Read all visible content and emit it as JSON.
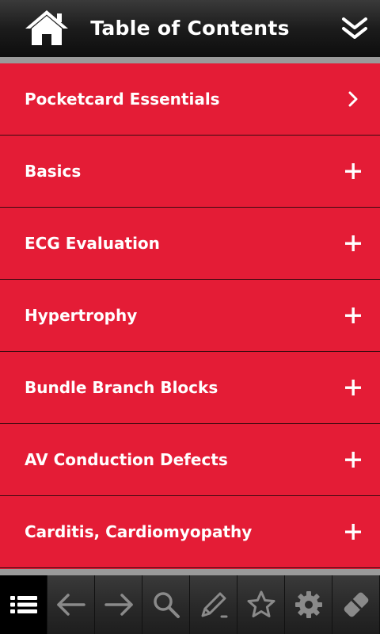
{
  "header": {
    "title": "Table of Contents",
    "home_icon": "home-icon",
    "collapse_icon": "double-chevron-down-icon"
  },
  "colors": {
    "accent": "#e41c36",
    "header_bg": "#1c1c1c",
    "separator": "#9a9a9a"
  },
  "toc": {
    "items": [
      {
        "label": "Pocketcard Essentials",
        "icon": "chevron-right-icon"
      },
      {
        "label": "Basics",
        "icon": "plus-icon"
      },
      {
        "label": "ECG Evaluation",
        "icon": "plus-icon"
      },
      {
        "label": "Hypertrophy",
        "icon": "plus-icon"
      },
      {
        "label": "Bundle Branch Blocks",
        "icon": "plus-icon"
      },
      {
        "label": "AV Conduction Defects",
        "icon": "plus-icon"
      },
      {
        "label": "Carditis, Cardiomyopathy",
        "icon": "plus-icon"
      }
    ]
  },
  "toolbar": {
    "buttons": [
      {
        "icon": "list-icon",
        "active": true
      },
      {
        "icon": "arrow-left-icon",
        "active": false
      },
      {
        "icon": "arrow-right-icon",
        "active": false
      },
      {
        "icon": "search-icon",
        "active": false
      },
      {
        "icon": "pencil-icon",
        "active": false
      },
      {
        "icon": "star-icon",
        "active": false
      },
      {
        "icon": "gear-icon",
        "active": false
      },
      {
        "icon": "eraser-icon",
        "active": false
      }
    ]
  }
}
